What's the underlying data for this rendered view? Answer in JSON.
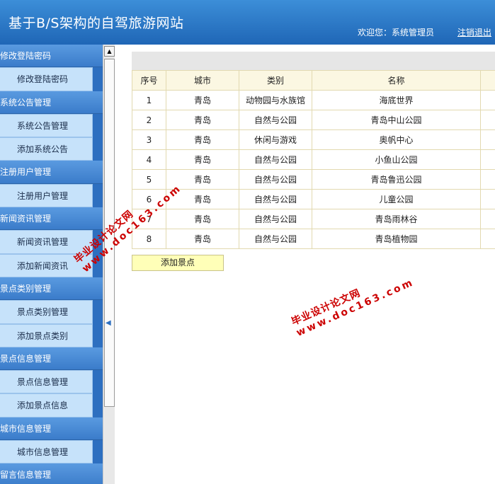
{
  "header": {
    "title": "基于B/S架构的自驾旅游网站",
    "welcome": "欢迎您：系统管理员",
    "logout": "注销退出"
  },
  "sidebar": {
    "sections": [
      {
        "label": "修改登陆密码",
        "items": [
          "修改登陆密码"
        ]
      },
      {
        "label": "系统公告管理",
        "items": [
          "系统公告管理",
          "添加系统公告"
        ]
      },
      {
        "label": "注册用户管理",
        "items": [
          "注册用户管理"
        ]
      },
      {
        "label": "新闻资讯管理",
        "items": [
          "新闻资讯管理",
          "添加新闻资讯"
        ]
      },
      {
        "label": "景点类别管理",
        "items": [
          "景点类别管理",
          "添加景点类别"
        ]
      },
      {
        "label": "景点信息管理",
        "items": [
          "景点信息管理",
          "添加景点信息"
        ]
      },
      {
        "label": "城市信息管理",
        "items": [
          "城市信息管理"
        ]
      },
      {
        "label": "留言信息管理",
        "items": []
      }
    ]
  },
  "table": {
    "headers": [
      "序号",
      "城市",
      "类别",
      "名称"
    ],
    "rows": [
      [
        "1",
        "青岛",
        "动物园与水族馆",
        "海底世界"
      ],
      [
        "2",
        "青岛",
        "自然与公园",
        "青岛中山公园"
      ],
      [
        "3",
        "青岛",
        "休闲与游戏",
        "奥帆中心"
      ],
      [
        "4",
        "青岛",
        "自然与公园",
        "小鱼山公园"
      ],
      [
        "5",
        "青岛",
        "自然与公园",
        "青岛鲁迅公园"
      ],
      [
        "6",
        "青岛",
        "自然与公园",
        "儿童公园"
      ],
      [
        "7",
        "青岛",
        "自然与公园",
        "青岛雨林谷"
      ],
      [
        "8",
        "青岛",
        "自然与公园",
        "青岛植物园"
      ]
    ]
  },
  "add_button": "添加景点",
  "watermark": {
    "line1": "毕业设计论文网",
    "line2": "www.doc163.com"
  },
  "icons": {
    "scroll_up": "scroll-up-arrow-icon",
    "collapse": "collapse-left-arrow-icon"
  },
  "colors": {
    "header": "#2a78c8",
    "sidebar": "#2d6fc0",
    "sidebar_item": "#c6e2fa",
    "table_header": "#fbf7e2",
    "button": "#ffffb8",
    "watermark": "#cc0000"
  }
}
